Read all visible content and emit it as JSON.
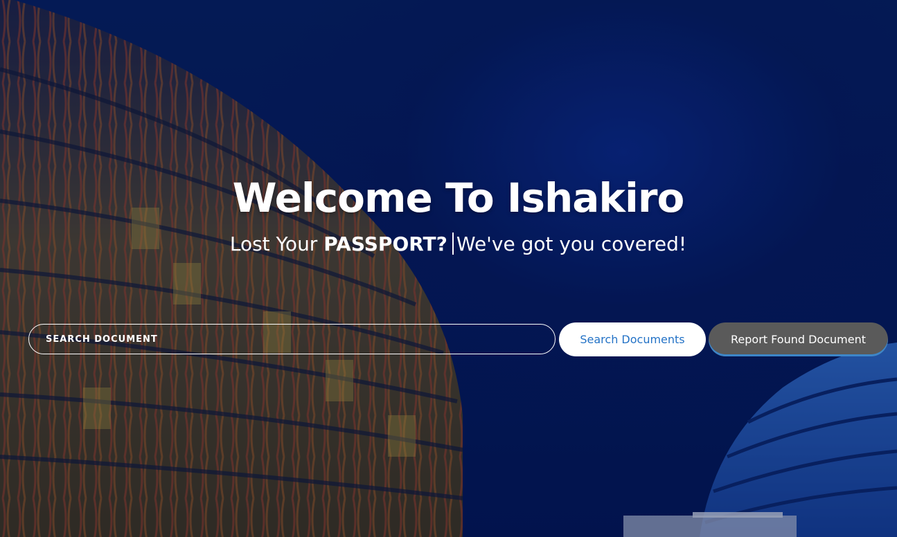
{
  "hero": {
    "title": "Welcome To Ishakiro",
    "subtitle_lead": "Lost Your",
    "subtitle_highlight": "PASSPORT?",
    "subtitle_tail": "We've got you covered!"
  },
  "search": {
    "placeholder": "SEARCH DOCUMENT",
    "value": ""
  },
  "buttons": {
    "search_label": "Search Documents",
    "report_label": "Report Found Document"
  },
  "colors": {
    "background": "#04174f",
    "search_button_text": "#2372c6",
    "report_button_bg": "#5a5a5a",
    "report_button_underline": "#3d86c9"
  }
}
